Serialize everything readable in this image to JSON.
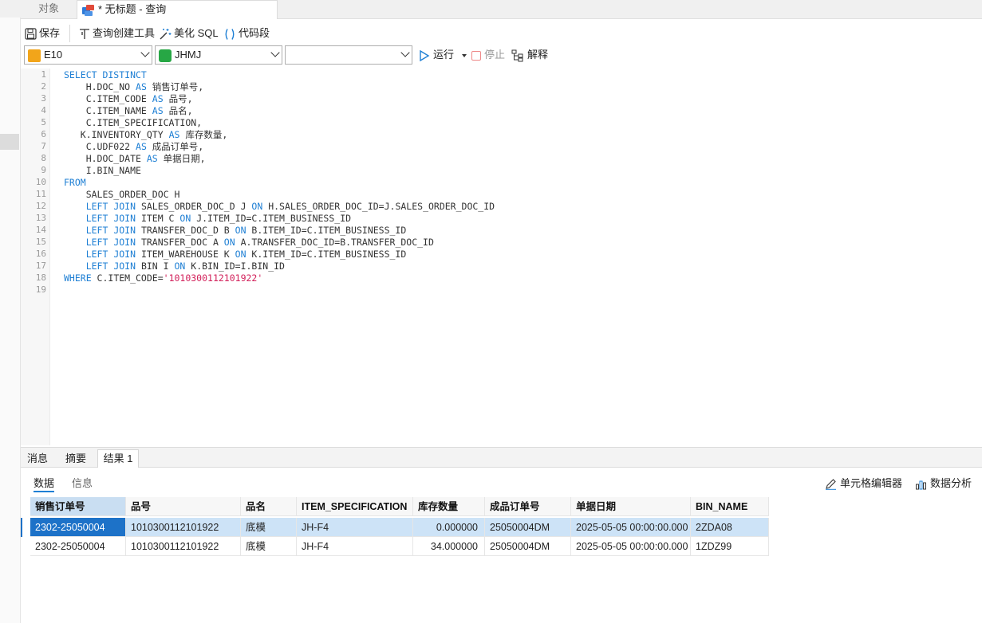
{
  "tabs": {
    "objects": "对象",
    "query": "* 无标题 - 查询"
  },
  "toolbar": {
    "save": "保存",
    "query_builder": "查询创建工具",
    "beautify": "美化 SQL",
    "snippet": "代码段"
  },
  "selectors": {
    "connection": "E10",
    "database": "JHMJ",
    "schema": "",
    "run": "运行",
    "stop": "停止",
    "explain": "解释"
  },
  "editor": {
    "line_numbers": [
      "1",
      "2",
      "3",
      "4",
      "5",
      "6",
      "7",
      "8",
      "9",
      "10",
      "11",
      "12",
      "13",
      "14",
      "15",
      "16",
      "17",
      "18",
      "19"
    ]
  },
  "bottom_tabs": {
    "messages": "消息",
    "summary": "摘要",
    "result1": "结果 1"
  },
  "subtabs": {
    "data": "数据",
    "info": "信息",
    "cell_editor": "单元格编辑器",
    "data_analysis": "数据分析"
  },
  "results": {
    "columns": [
      "销售订单号",
      "品号",
      "品名",
      "ITEM_SPECIFICATION",
      "库存数量",
      "成品订单号",
      "单据日期",
      "BIN_NAME"
    ],
    "rows": [
      [
        "2302-25050004",
        "1010300112101922",
        "底模",
        "JH-F4",
        "0.000000",
        "25050004DM",
        "2025-05-05 00:00:00.000",
        "2ZDA08"
      ],
      [
        "2302-25050004",
        "1010300112101922",
        "底模",
        "JH-F4",
        "34.000000",
        "25050004DM",
        "2025-05-05 00:00:00.000",
        "1ZDZ99"
      ]
    ]
  },
  "colors": {
    "keyword": "#1e7fd4",
    "string": "#d2205a",
    "selected_cell": "#1d72c8",
    "selected_row": "#cde3f7"
  }
}
